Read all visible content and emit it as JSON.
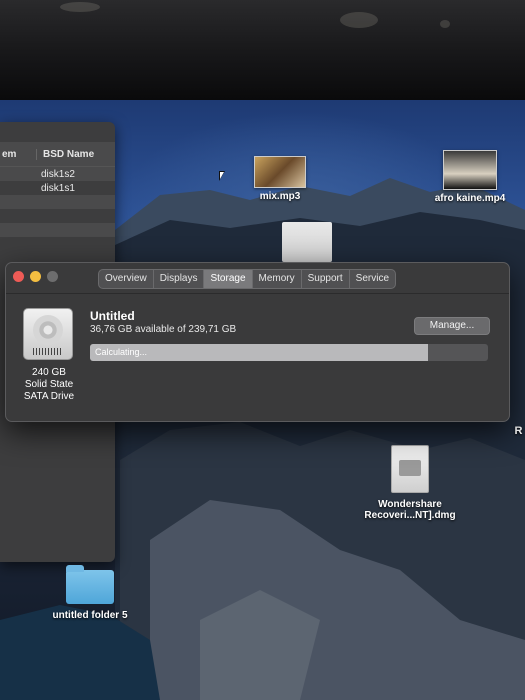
{
  "disk_utility": {
    "columns": [
      "em",
      "BSD Name"
    ],
    "rows": [
      {
        "a": "",
        "b": "disk1s2"
      },
      {
        "a": "",
        "b": "disk1s1"
      },
      {
        "a": "",
        "b": ""
      },
      {
        "a": "",
        "b": ""
      },
      {
        "a": "",
        "b": ""
      },
      {
        "a": "",
        "b": ""
      }
    ]
  },
  "desktop": {
    "icons": {
      "mix": "mix.mp3",
      "afro": "afro kaine.mp4",
      "wondershare_line1": "Wondershare",
      "wondershare_line2": "Recoveri...NT].dmg",
      "folder": "untitled folder 5",
      "edge_letter": "R"
    }
  },
  "about_window": {
    "tabs": [
      "Overview",
      "Displays",
      "Storage",
      "Memory",
      "Support",
      "Service"
    ],
    "active_tab": "Storage",
    "drive": {
      "capacity": "240 GB",
      "type": "Solid State",
      "interface": "SATA Drive"
    },
    "volume": {
      "name": "Untitled",
      "available": "36,76 GB available of 239,71 GB",
      "manage_label": "Manage...",
      "bar_label": "Calculating...",
      "bar_fill_fraction": 0.85
    }
  },
  "colors": {
    "close": "#ee5b56",
    "minimize": "#f4be41",
    "zoom_disabled": "#6d6d6e",
    "window_bg": "#3a3a3b"
  }
}
